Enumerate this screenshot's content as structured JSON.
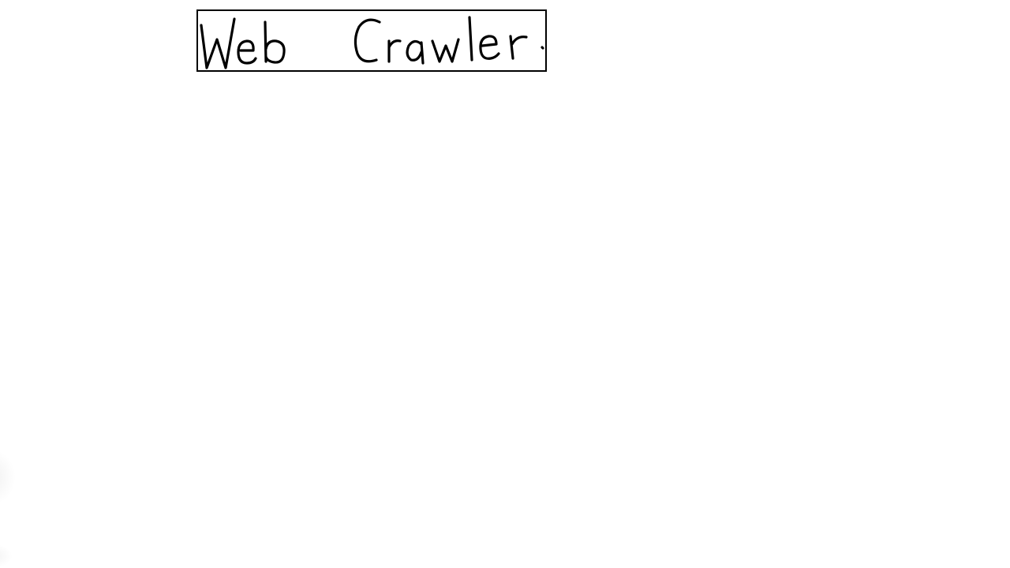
{
  "title": {
    "text": "Web Crawler."
  },
  "colors": {
    "background": "#ffffff",
    "ink": "#000000"
  }
}
